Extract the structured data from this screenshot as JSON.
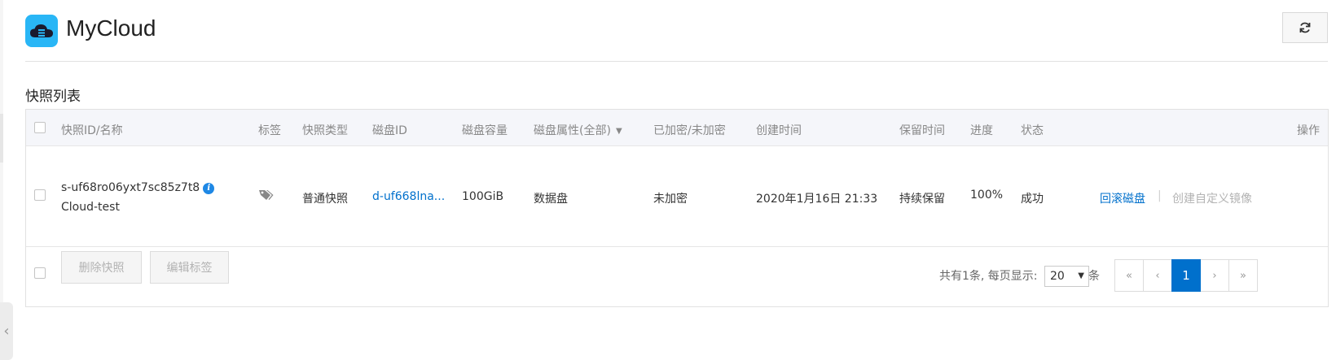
{
  "app": {
    "title": "MyCloud"
  },
  "section": {
    "title": "快照列表"
  },
  "table": {
    "columns": [
      "快照ID/名称",
      "标签",
      "快照类型",
      "磁盘ID",
      "磁盘容量",
      "磁盘属性(全部)",
      "已加密/未加密",
      "创建时间",
      "保留时间",
      "进度",
      "状态",
      "操作"
    ],
    "rows": [
      {
        "snapshot_id": "s-uf68ro06yxt7sc85z7t8",
        "name": "Cloud-test",
        "type": "普通快照",
        "disk_id": "d-uf668lna...",
        "capacity": "100GiB",
        "disk_attr": "数据盘",
        "encrypted": "未加密",
        "created": "2020年1月16日 21:33",
        "retention": "持续保留",
        "progress": "100%",
        "status": "成功",
        "action_rollback": "回滚磁盘",
        "action_separator": "|",
        "action_create_image": "创建自定义镜像"
      }
    ]
  },
  "footer": {
    "delete_label": "删除快照",
    "edit_tags_label": "编辑标签",
    "total_text": "共有1条, 每页显示:",
    "page_size": "20",
    "per_unit": "条",
    "pager": {
      "first": "«",
      "prev": "‹",
      "current": "1",
      "next": "›",
      "last": "»"
    }
  },
  "colors": {
    "accent": "#0070cc",
    "logo_bg": "#29b6f6",
    "header_bg": "#f5f6fa"
  }
}
